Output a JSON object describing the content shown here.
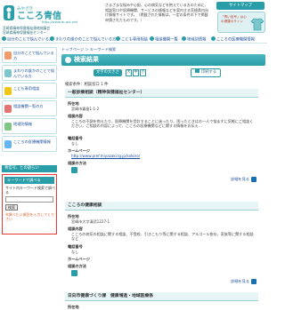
{
  "header": {
    "logo_kana": "みやざき",
    "logo_text": "こころ青信",
    "logo_url": "http://www.m-aoi.net",
    "sub1": "宮崎県精神保健福祉連絡協議会",
    "sub2": "宮崎県精神保健福祉センター",
    "intro": "さまざまな悩みや心配、心の病気などを抱えている方のために、相談窓口や医療機関、サービスの情報などを案内する宮崎県内向け情報サイトです。（掲載された情報は、一定の条件の下で掲載申請されたものです。）",
    "sitemap": "サイトマップ",
    "banner": "「青い信号」は心の健康のサイン",
    "colors": {
      "teal": "#2a9ea8",
      "link": "#1a4f9a",
      "alert": "#e53935"
    }
  },
  "nav": [
    "自分のことで悩んでいる方",
    "まわりの誰かのことで悩んでいる方",
    "こども専用相談",
    "相談機関一覧",
    "地域別情報",
    "こころの医療機関情報"
  ],
  "sidebar": {
    "items": [
      "自分のことで悩んでいる方",
      "まわりの誰かのことで悩んでいる方",
      "こども専用相談",
      "相談機関一覧の方",
      "地域別情報",
      "こころの医療機関情報"
    ],
    "section_head": "青信号、との語らい",
    "search": {
      "title": "キーワードで調べる",
      "desc": "サイト内キーワード検索で調べる",
      "input_value": "",
      "button": "検索",
      "note": "※調べたい項目を入力してください"
    }
  },
  "main": {
    "breadcrumb": "トップページ ＞ キーワード検索",
    "title": "検索結果",
    "fontsize_label": "文字の大きさ",
    "fontsizes": [
      "大",
      "中",
      "小"
    ],
    "print": "印刷する",
    "condition": "検索条件：相談窓口 1 件",
    "results": [
      {
        "title": "一般診療相談（精神保健福祉センター）",
        "addr_label": "所在地",
        "addr": "宮崎市霧島1-1-2",
        "content_label": "相談内容",
        "content": "こころの不調を抱えたり、医療機関を受診することに迷ったり、困ったときはお一人で悩まずに気軽にご相談ください。ご相談の内容によって、こころの医療機関などに関する情報をお伝え...",
        "tel_label": "電話番号",
        "tel": "なし",
        "hp_label": "ホームページ",
        "hp": "http://www.pref.miyazaki.lg.jp/kokoro/",
        "target_label": "相談の方法",
        "detail": "詳細を見る"
      },
      {
        "title": "こころの健康相談",
        "addr_label": "所在地",
        "addr": "宮崎市大字清武1227-1",
        "content_label": "相談内容",
        "content": "こころの病気の相談に関する相談、不登校、引きこもり等に関する相談、アルコール依存、家族等に関する相談など",
        "tel_label": "電話番号",
        "tel": "なし",
        "hp_label": "ホームページ",
        "hp": "",
        "target_label": "相談の方法",
        "detail": "詳細を見る"
      },
      {
        "title": "日向市健康づくり課　健康増進・地域医療係",
        "addr_label": "所在地",
        "addr": ""
      }
    ]
  }
}
